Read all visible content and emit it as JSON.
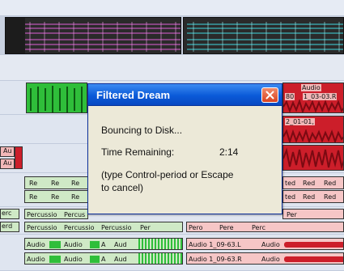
{
  "dialog": {
    "title": "Filtered Dream",
    "status": "Bouncing to Disk...",
    "time_label": "Time Remaining:",
    "time_value": "2:14",
    "hint_line1": "(type Control-period or Escape",
    "hint_line2": "to cancel)"
  },
  "regions": {
    "audio_top_a": "Audio",
    "audio_top_b": "80",
    "audio_top_c": "1_03-03.R",
    "clip_2_01": "2_01-01,",
    "aud_a": "Au",
    "aud_b": "Au",
    "red_1": "Re",
    "red_2": "Re",
    "red_3": "Re",
    "red_4": "Re",
    "red_5": "Re",
    "red_6": "Re",
    "ted_1": "ted",
    "ted_2": "ted",
    "red_r1": "Red",
    "red_r2": "Red",
    "red_r3": "Red",
    "red_r4": "Red",
    "perc_label": "erc",
    "perc_label2": "erd",
    "percussio": "Percussio",
    "percus": "Percus",
    "percussio2": "Percussio",
    "percussio3": "Percussio",
    "percussio4": "Percussio",
    "perc5": "Perc",
    "perc6": "Per",
    "pero": "Pero",
    "pere": "Pere",
    "perc_right": "Per",
    "audio_1": "Audio",
    "audio_2": "Audio",
    "audio_3": "A",
    "audio_4": "Aud",
    "audio_5": "Audio",
    "audio_6": "Audio",
    "audio_7": "A",
    "audio_8": "Aud",
    "audio_9_63_L": "Audio 1_09-63.L",
    "audio_9_63_R": "Audio 1_09-63.R",
    "audio_r1": "Audio",
    "audio_r2": "Audio"
  },
  "colors": {
    "dialog_titlebar": "#0a5ad8",
    "close_button": "#d9421f",
    "dialog_body": "#ece9d8",
    "green_region": "#2fbe3a",
    "red_region": "#cc1e2a",
    "magenta_wave": "#e060d8",
    "cyan_wave": "#40d8e0"
  },
  "icons": {
    "close": "close-x-icon"
  }
}
